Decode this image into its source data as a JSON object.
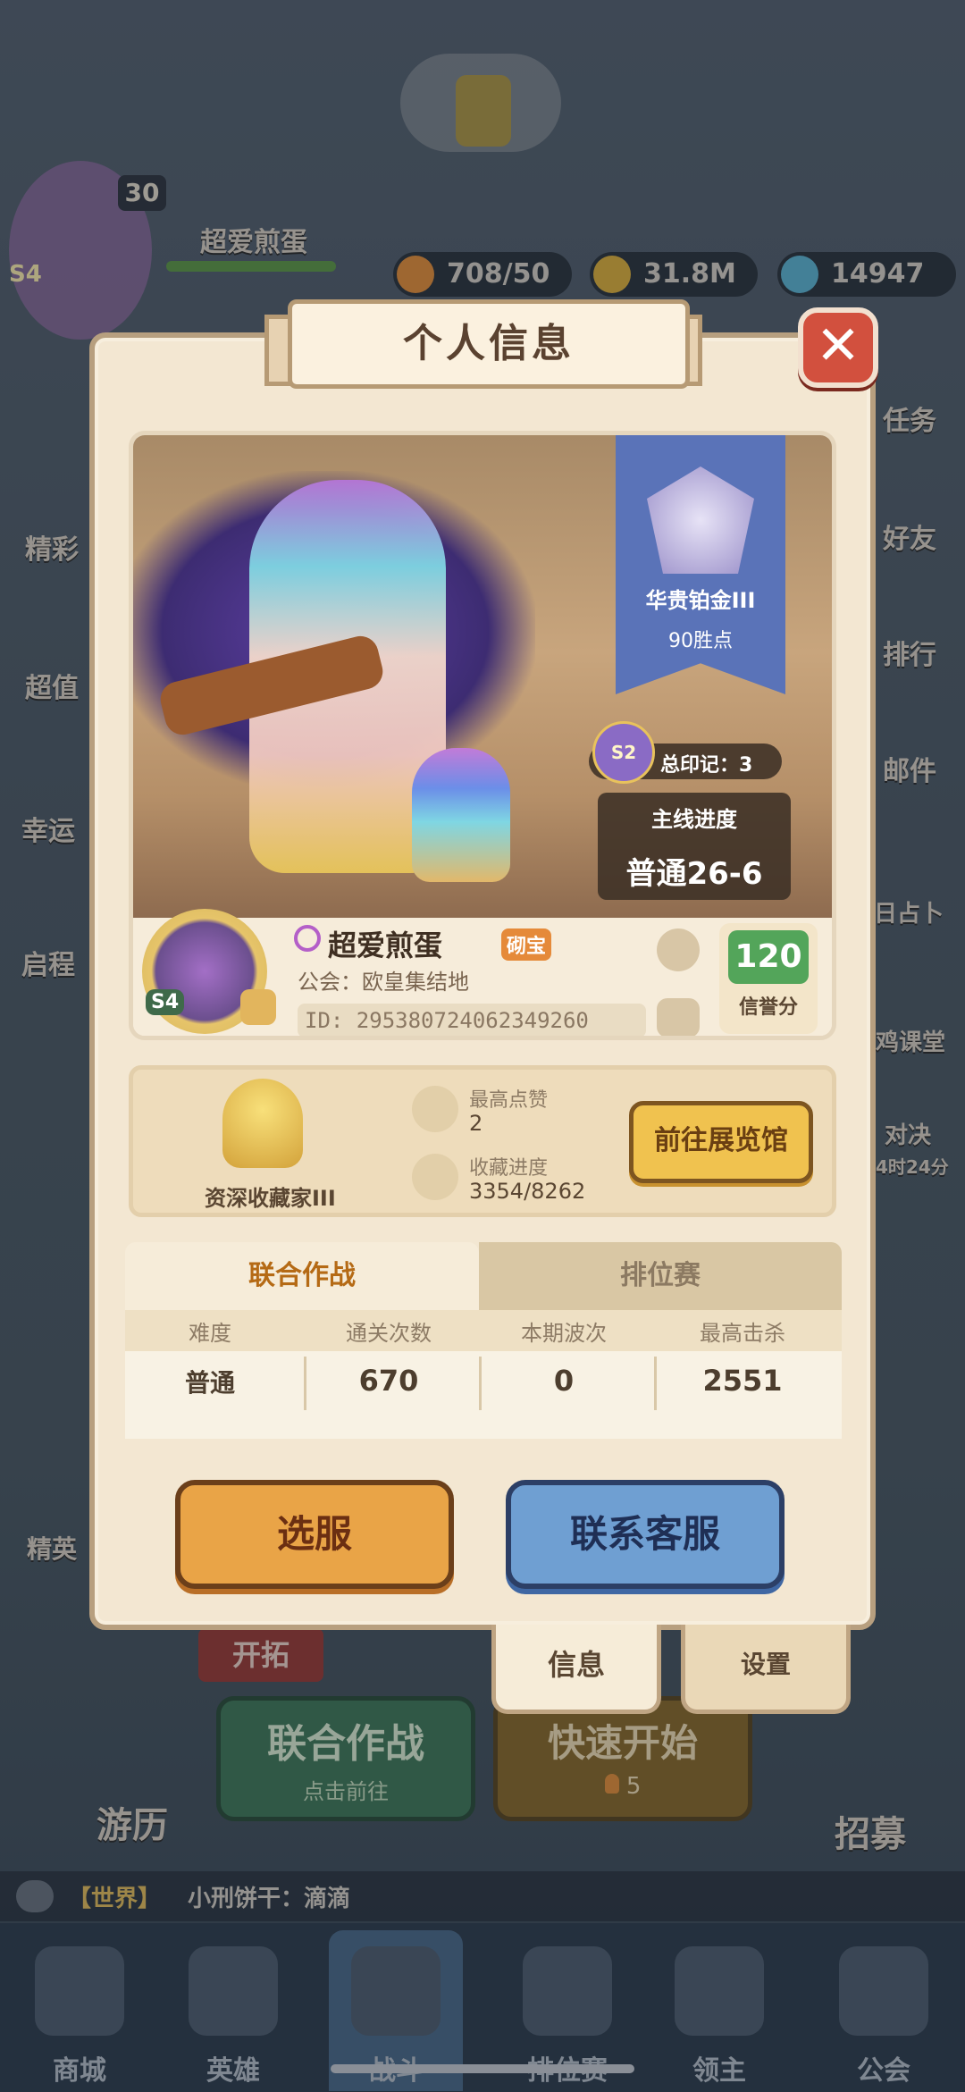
{
  "background": {
    "player_name": "超爱煎蛋",
    "level": "30",
    "season_badge": "S4",
    "energy": "708/50",
    "gold": "31.8M",
    "gems": "14947",
    "left_menu": [
      "精彩",
      "超值",
      "幸运",
      "启程",
      "精英"
    ],
    "right_menu": [
      "任务",
      "好友",
      "排行",
      "邮件",
      "日占卜",
      "鸡课堂",
      "对决",
      "4时24分"
    ],
    "world_chat": {
      "channel": "【世界】",
      "text": "小刑饼干：滴滴"
    },
    "lobby_buttons": {
      "coop": "联合作战",
      "coop_sub": "点击前往",
      "quick_start": "快速开始",
      "quick_start_cost": "5",
      "explore": "开拓",
      "travel": "游历",
      "recruit": "招募"
    },
    "bottom_tabs": [
      "商城",
      "英雄",
      "战斗",
      "排位赛",
      "领主",
      "公会"
    ]
  },
  "panel": {
    "title": "个人信息",
    "rank": {
      "name": "华贵铂金III",
      "points": "90胜点"
    },
    "total_marks": "总印记：3",
    "season_small": "S2",
    "main_progress_label": "主线进度",
    "main_progress_value": "普通26-6",
    "player": {
      "name": "超爱煎蛋",
      "tag": "砌宝",
      "guild": "公会：欧皇集结地",
      "id": "ID: 295380724062349260",
      "avatar_season": "S4"
    },
    "credit": {
      "value": "120",
      "label": "信誉分"
    },
    "collection": {
      "title": "资深收藏家III",
      "likes_label": "最高点赞",
      "likes_value": "2",
      "progress_label": "收藏进度",
      "progress_value": "3354/8262",
      "goto_button": "前往展览馆"
    },
    "tabs": [
      "联合作战",
      "排位赛"
    ],
    "table": {
      "headers": [
        "难度",
        "通关次数",
        "本期波次",
        "最高击杀"
      ],
      "row": [
        "普通",
        "670",
        "0",
        "2551"
      ]
    },
    "buttons": {
      "select_server": "选服",
      "contact_service": "联系客服"
    },
    "side_tabs": [
      "信息",
      "设置"
    ]
  },
  "colors": {
    "accent_orange": "#e9a447",
    "accent_blue": "#6f9fd2",
    "close_red": "#d2503e"
  }
}
